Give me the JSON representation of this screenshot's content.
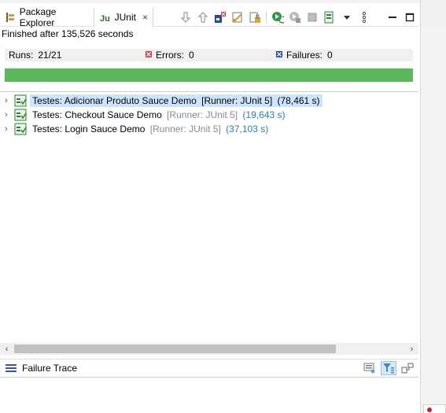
{
  "tabs": {
    "package_explorer": "Package Explorer",
    "junit": "JUnit",
    "close_glyph": "×"
  },
  "toolbar": {
    "icons": [
      "next-failure-icon",
      "previous-failure-icon",
      "failures-only-icon",
      "skipped-only-icon",
      "scroll-lock-icon",
      "rerun-icon",
      "rerun-failed-first-icon",
      "stop-icon",
      "history-icon",
      "dropdown-icon",
      "view-menu-icon",
      "minimize-icon",
      "maximize-icon"
    ]
  },
  "status": {
    "text": "Finished after 135,526 seconds"
  },
  "counters": {
    "runs_label": "Runs:",
    "runs_value": "21/21",
    "errors_label": "Errors:",
    "errors_value": "0",
    "failures_label": "Failures:",
    "failures_value": "0"
  },
  "progress": {
    "fraction": 1.0,
    "color": "#5cb85c"
  },
  "tree": {
    "items": [
      {
        "name": "Testes: Adicionar Produto Sauce Demo",
        "runner": "[Runner: JUnit 5]",
        "time": "(78,461 s)",
        "selected": true
      },
      {
        "name": "Testes: Checkout Sauce Demo",
        "runner": "[Runner: JUnit 5]",
        "time": "(19,643 s)",
        "selected": false
      },
      {
        "name": "Testes: Login Sauce Demo",
        "runner": "[Runner: JUnit 5]",
        "time": "(37,103 s)",
        "selected": false
      }
    ]
  },
  "failure_trace": {
    "title": "Failure Trace"
  },
  "colors": {
    "accent_selection": "#cce5ff",
    "time_text": "#2a7ea8",
    "runner_text": "#8a8a8a",
    "error_mark": "#d9363e",
    "failure_mark": "#1f4f8f"
  }
}
